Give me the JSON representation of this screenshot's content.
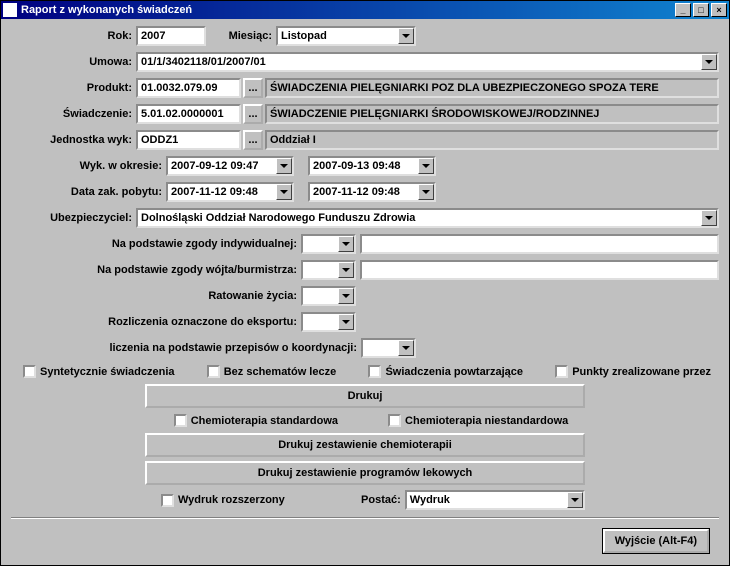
{
  "window": {
    "title": "Raport z wykonanych świadczeń",
    "minimize": "_",
    "maximize": "□",
    "close": "×"
  },
  "labels": {
    "rok": "Rok:",
    "miesiac": "Miesiąc:",
    "umowa": "Umowa:",
    "produkt": "Produkt:",
    "swiadczenie": "Świadczenie:",
    "jednostka": "Jednostka wyk:",
    "wyk_okres": "Wyk. w okresie:",
    "data_zak": "Data zak. pobytu:",
    "ubezp": "Ubezpieczyciel:",
    "pods_indyw": "Na podstawie zgody indywidualnej:",
    "pods_wojt": "Na podstawie zgody wójta/burmistrza:",
    "ratowanie": "Ratowanie życia:",
    "rozlicz": "Rozliczenia oznaczone do eksportu:",
    "koordyn": "liczenia na podstawie przepisów o koordynacji:",
    "postac": "Postać:",
    "dots": "..."
  },
  "values": {
    "rok": "2007",
    "miesiac": "Listopad",
    "umowa": "01/1/3402118/01/2007/01",
    "produkt_code": "01.0032.079.09",
    "produkt_desc": "ŚWIADCZENIA PIELĘGNIARKI POZ DLA UBEZPIECZONEGO SPOZA TERE",
    "swiad_code": "5.01.02.0000001",
    "swiad_desc": "ŚWIADCZENIE PIELĘGNIARKI ŚRODOWISKOWEJ/RODZINNEJ",
    "jedn_code": "ODDZ1",
    "jedn_desc": "Oddział I",
    "wyk_from": "2007-09-12 09:47",
    "wyk_to": "2007-09-13 09:48",
    "zak_from": "2007-11-12 09:48",
    "zak_to": "2007-11-12 09:48",
    "ubezpieczyciel": "Dolnośląski Oddział Narodowego Funduszu Zdrowia",
    "postac": "Wydruk"
  },
  "checks": {
    "syntet": "Syntetycznie świadczenia",
    "bez_schem": "Bez schematów lecze",
    "powtarz": "Świadczenia powtarzające",
    "punkty": "Punkty zrealizowane przez",
    "chemio_std": "Chemioterapia standardowa",
    "chemio_niestd": "Chemioterapia niestandardowa",
    "wydruk_rozsz": "Wydruk rozszerzony"
  },
  "buttons": {
    "drukuj": "Drukuj",
    "druk_chemio": "Drukuj zestawienie chemioterapii",
    "druk_lek": "Drukuj zestawienie programów lekowych",
    "wyjscie": "Wyjście (Alt-F4)"
  }
}
